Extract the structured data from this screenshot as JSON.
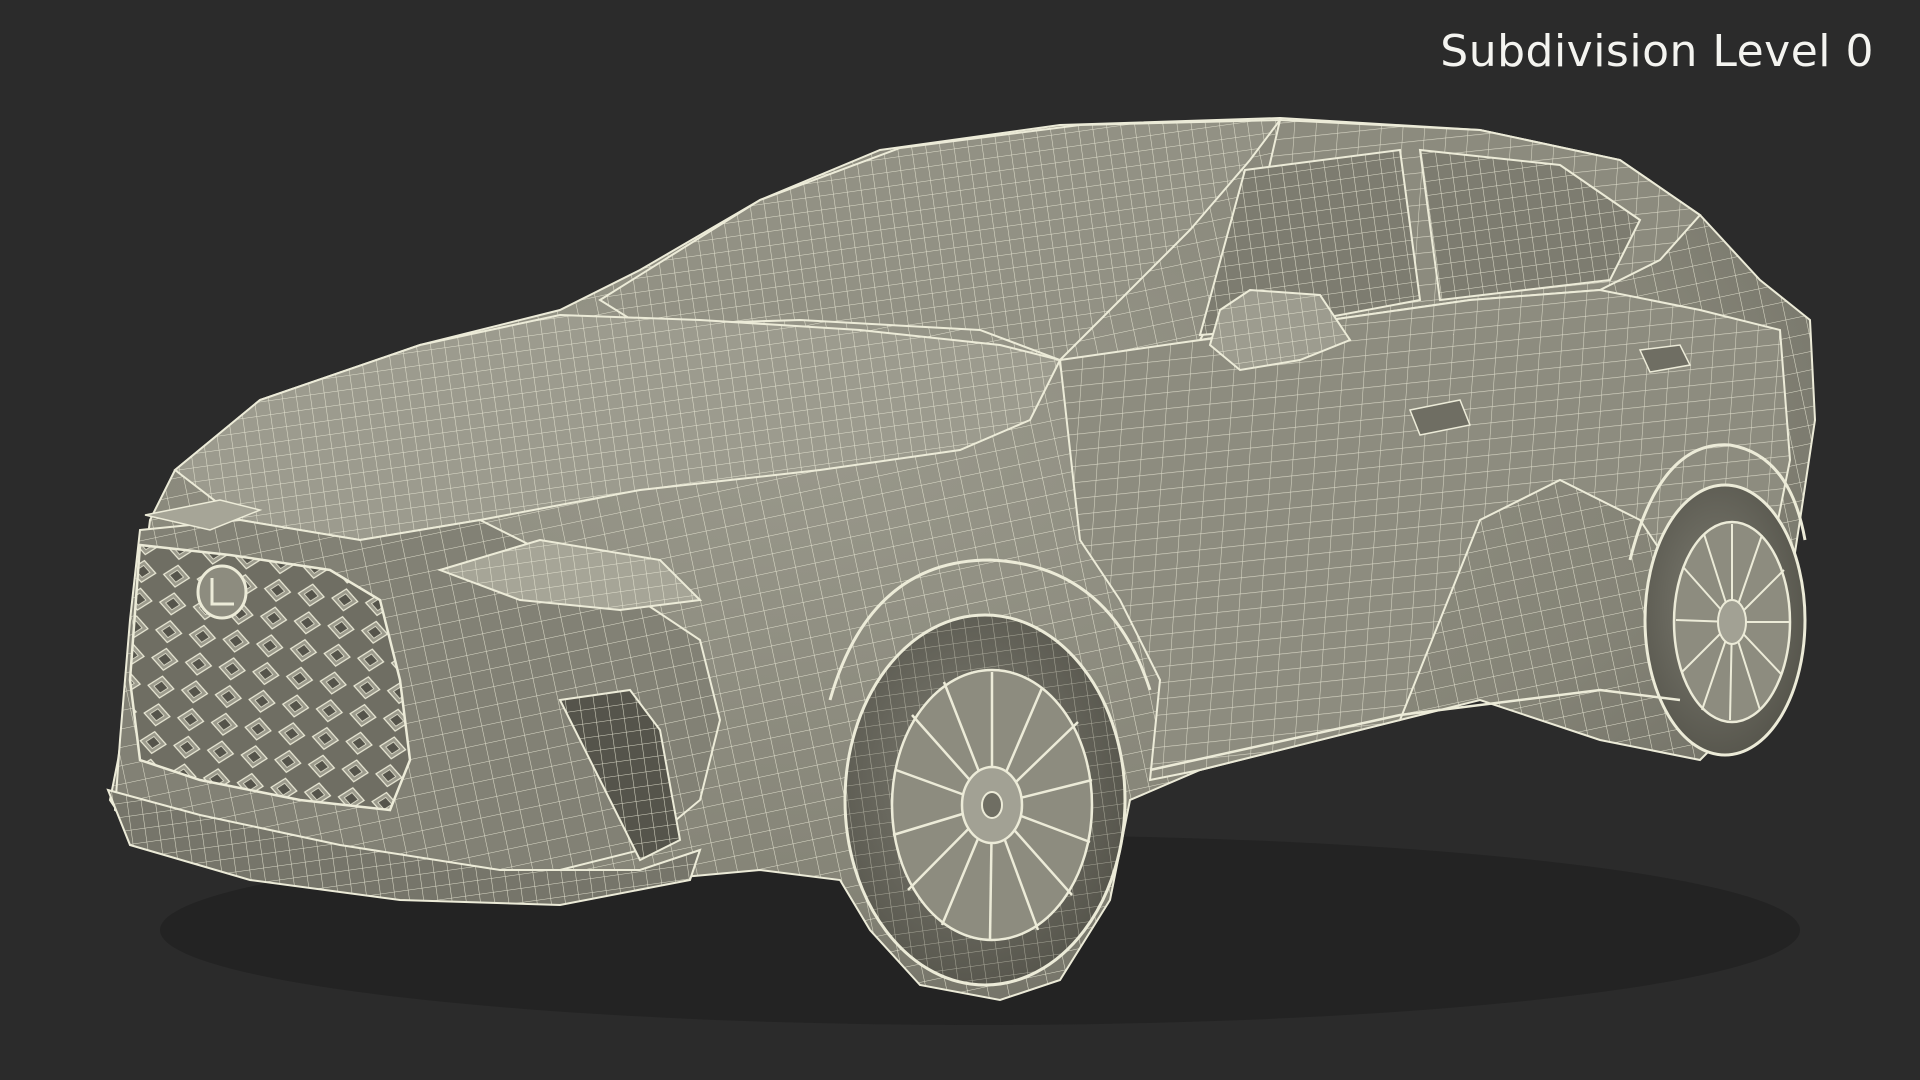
{
  "viewport": {
    "label": "Subdivision Level 0",
    "background_color": "#2b2b2b",
    "surface_color": "#8a897c",
    "wire_color": "#ecebd8",
    "shadow_color": "#5f5e54"
  },
  "scene": {
    "subject_icon": "suv-wireframe-icon"
  }
}
